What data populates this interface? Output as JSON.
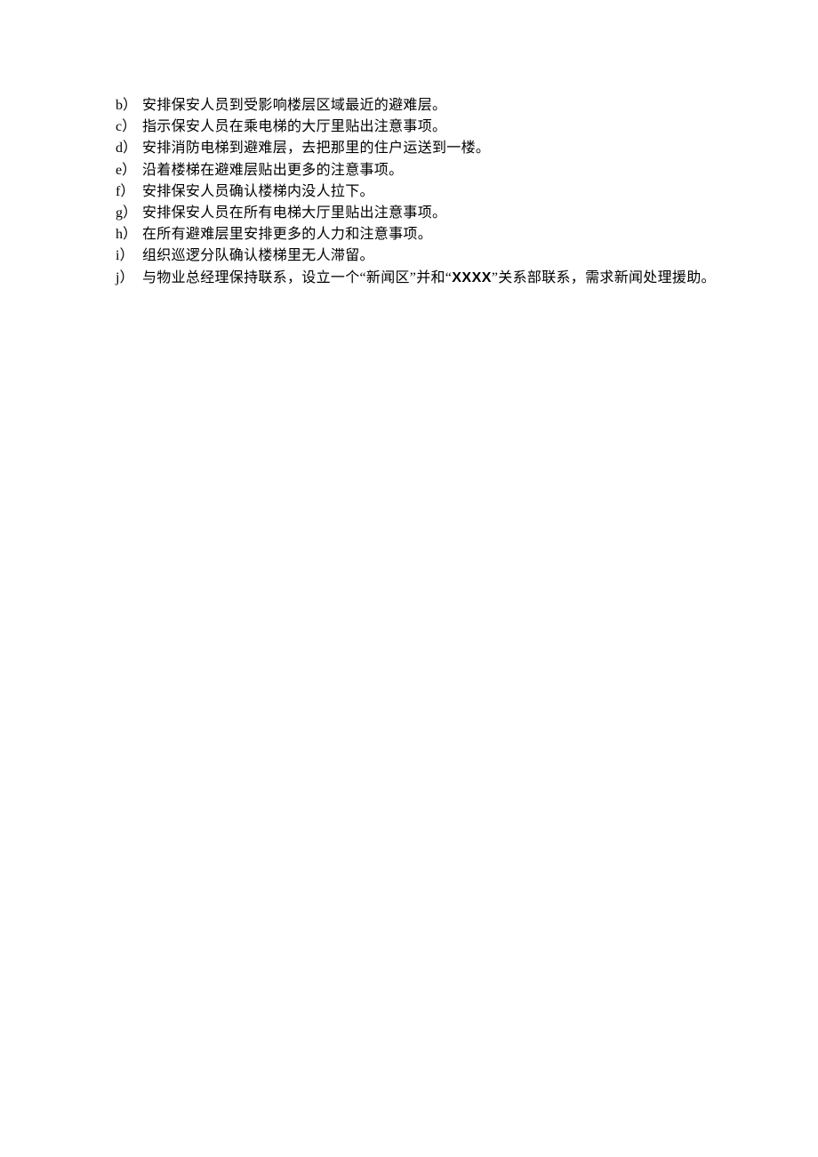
{
  "items": [
    {
      "marker_letter": "b",
      "marker_paren": "）",
      "text": "安排保安人员到受影响楼层区域最近的避难层。"
    },
    {
      "marker_letter": "c",
      "marker_paren": "）",
      "text": "指示保安人员在乘电梯的大厅里贴出注意事项。"
    },
    {
      "marker_letter": "d",
      "marker_paren": "）",
      "text": "安排消防电梯到避难层，去把那里的住户运送到一楼。"
    },
    {
      "marker_letter": "e",
      "marker_paren": "）",
      "text": "沿着楼梯在避难层贴出更多的注意事项。"
    },
    {
      "marker_letter": "f",
      "marker_paren": "）",
      "text": "安排保安人员确认楼梯内没人拉下。"
    },
    {
      "marker_letter": "g",
      "marker_paren": "）",
      "text": "安排保安人员在所有电梯大厅里贴出注意事项。"
    },
    {
      "marker_letter": "h",
      "marker_paren": "）",
      "text": "在所有避难层里安排更多的人力和注意事项。"
    },
    {
      "marker_letter": "i",
      "marker_paren": "）",
      "text": "组织巡逻分队确认楼梯里无人滞留。"
    },
    {
      "marker_letter": "j",
      "marker_paren": "）",
      "text_before": "与物业总经理保持联系，设立一个“新闻区”并和“",
      "text_bold": "XXXX",
      "text_after": "”关系部联系，需求新闻处理援助。"
    }
  ]
}
